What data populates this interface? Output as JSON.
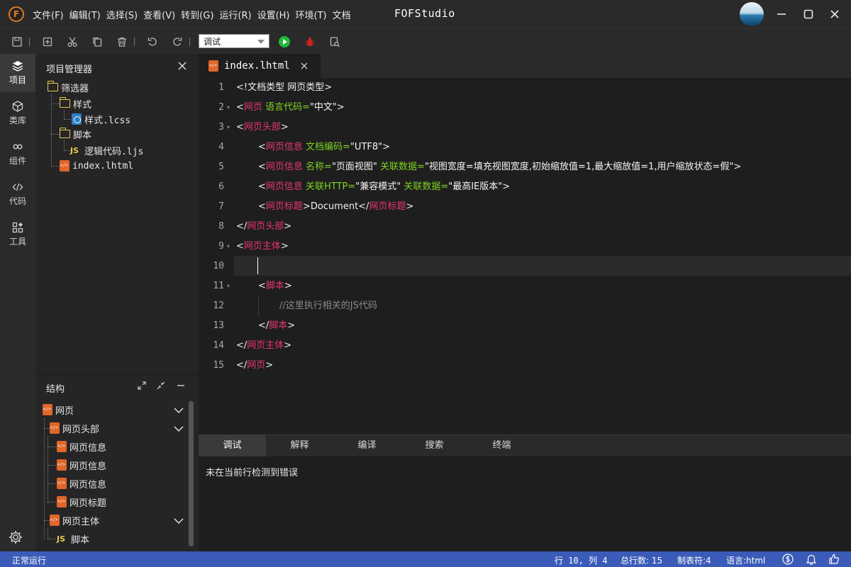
{
  "app": {
    "logo_letter": "F",
    "title": "FOFStudio",
    "menu": [
      "文件(F)",
      "编辑(T)",
      "选择(S)",
      "查看(V)",
      "转到(G)",
      "运行(R)",
      "设置(H)",
      "环境(T)",
      "文档"
    ]
  },
  "toolbar": {
    "mode_value": "调试",
    "icons": [
      "save-icon",
      "new-file-icon",
      "cut-icon",
      "copy-icon",
      "delete-icon",
      "undo-icon",
      "redo-icon",
      "run-icon",
      "debug-icon",
      "search-file-icon"
    ],
    "colors": {
      "run": "#1fb83b",
      "debug": "#cc2222"
    }
  },
  "activity": {
    "items": [
      {
        "label": "项目",
        "icon": "layers-icon"
      },
      {
        "label": "类库",
        "icon": "cube-icon"
      },
      {
        "label": "组件",
        "icon": "link-icon"
      },
      {
        "label": "代码",
        "icon": "code-icon"
      },
      {
        "label": "工具",
        "icon": "tools-icon"
      }
    ]
  },
  "project": {
    "title": "项目管理器",
    "tree": {
      "filter": "筛选器",
      "styles_folder": "样式",
      "styles_file": "样式.lcss",
      "scripts_folder": "脚本",
      "scripts_file": "逻辑代码.ljs",
      "index_file": "index.lhtml"
    },
    "js_badge": "JS"
  },
  "structure": {
    "title": "结构",
    "nodes": {
      "root": "网页",
      "head": "网页头部",
      "meta1": "网页信息",
      "meta2": "网页信息",
      "meta3": "网页信息",
      "title": "网页标题",
      "body": "网页主体",
      "script": "脚本"
    },
    "js_badge": "JS"
  },
  "editor": {
    "tab_label": "index.lhtml",
    "line_numbers": [
      "1",
      "2",
      "3",
      "4",
      "5",
      "6",
      "7",
      "8",
      "9",
      "10",
      "11",
      "12",
      "13",
      "14",
      "15"
    ],
    "lines": {
      "l1": {
        "a": "<!文档类型 网页类型>"
      },
      "l2": {
        "a": "<",
        "tag": "网页",
        "attr": " 语言代码=",
        "str": "\"中文\"",
        "z": ">"
      },
      "l3": {
        "a": "<",
        "tag": "网页头部",
        "z": ">"
      },
      "l4": {
        "a": "<",
        "tag": "网页信息",
        "attr": " 文档编码=",
        "str": "\"UTF8\"",
        "z": ">"
      },
      "l5": {
        "a": "<",
        "tag": "网页信息",
        "attr1": " 名称=",
        "str1": "\"页面视图\"",
        "attr2": " 关联数据=",
        "str2": "\"视图宽度=填充视图宽度,初始缩放值=1,最大缩放值=1,用户缩放状态=假\"",
        "z": ">"
      },
      "l6": {
        "a": "<",
        "tag": "网页信息",
        "attr1": " 关联HTTP=",
        "str1": "\"兼容模式\"",
        "attr2": " 关联数据=",
        "str2": "\"最高IE版本\"",
        "z": ">"
      },
      "l7": {
        "a": "<",
        "tag": "网页标题",
        "mid": ">Document</",
        "tag2": "网页标题",
        "z": ">"
      },
      "l8": {
        "a": "</",
        "tag": "网页头部",
        "z": ">"
      },
      "l9": {
        "a": "<",
        "tag": "网页主体",
        "z": ">"
      },
      "l11": {
        "a": "<",
        "tag": "脚本",
        "z": ">"
      },
      "l12": {
        "comment": "//这里执行相关的JS代码"
      },
      "l13": {
        "a": "</",
        "tag": "脚本",
        "z": ">"
      },
      "l14": {
        "a": "</",
        "tag": "网页主体",
        "z": ">"
      },
      "l15": {
        "a": "</",
        "tag": "网页",
        "z": ">"
      }
    }
  },
  "bottom": {
    "tabs": [
      "调试",
      "解释",
      "编译",
      "搜索",
      "终端"
    ],
    "message": "未在当前行检测到错误"
  },
  "status": {
    "running": "正常运行",
    "position": "行 10, 列 4",
    "total_lines": "总行数: 15",
    "tab_size": "制表符:4",
    "language": "语言:html",
    "bg_color": "#3b5bb8"
  }
}
